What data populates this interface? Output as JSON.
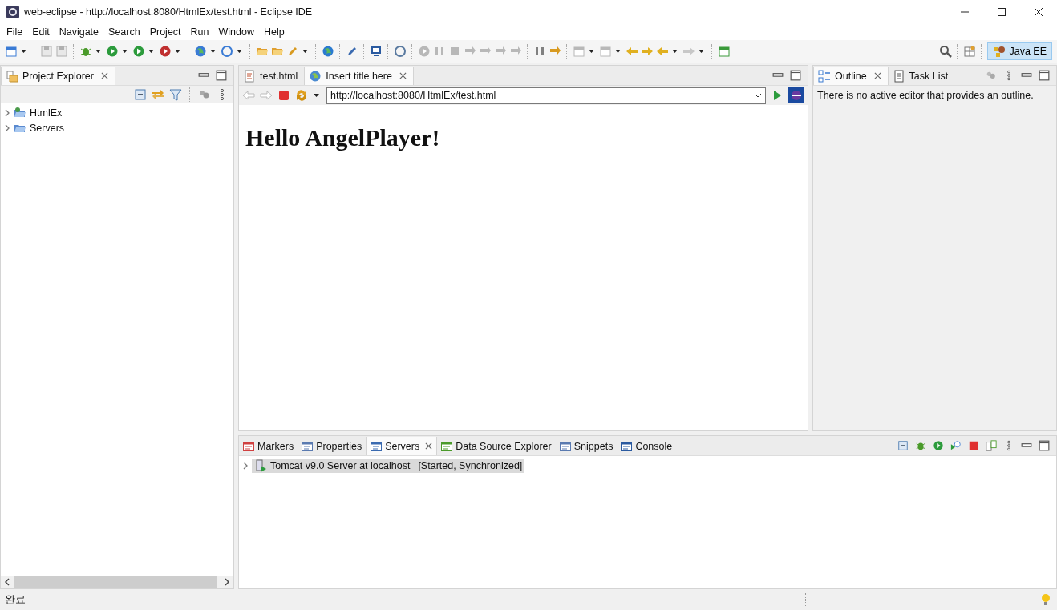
{
  "window": {
    "title": "web-eclipse - http://localhost:8080/HtmlEx/test.html - Eclipse IDE"
  },
  "menu": [
    "File",
    "Edit",
    "Navigate",
    "Search",
    "Project",
    "Run",
    "Window",
    "Help"
  ],
  "perspective": {
    "label": "Java EE",
    "selected": true
  },
  "project_explorer": {
    "tabs": [
      {
        "label": "Project Explorer",
        "selected": true
      }
    ],
    "items": [
      {
        "label": "HtmlEx",
        "expanded": false
      },
      {
        "label": "Servers",
        "expanded": false
      }
    ]
  },
  "editor": {
    "tabs": [
      {
        "label": "test.html",
        "selected": false
      },
      {
        "label": "Insert title here",
        "selected": true
      }
    ],
    "url": "http://localhost:8080/HtmlEx/test.html",
    "heading": "Hello AngelPlayer!"
  },
  "outline": {
    "tabs": [
      {
        "label": "Outline",
        "selected": true
      },
      {
        "label": "Task List",
        "selected": false
      }
    ],
    "message": "There is no active editor that provides an outline."
  },
  "bottom_panel": {
    "tabs": [
      {
        "label": "Markers",
        "selected": false
      },
      {
        "label": "Properties",
        "selected": false
      },
      {
        "label": "Servers",
        "selected": true
      },
      {
        "label": "Data Source Explorer",
        "selected": false
      },
      {
        "label": "Snippets",
        "selected": false
      },
      {
        "label": "Console",
        "selected": false
      }
    ],
    "servers": [
      {
        "name": "Tomcat v9.0 Server at localhost",
        "status": "[Started, Synchronized]",
        "selected": true,
        "expanded": false
      }
    ]
  },
  "status_bar": {
    "message": "완료"
  }
}
